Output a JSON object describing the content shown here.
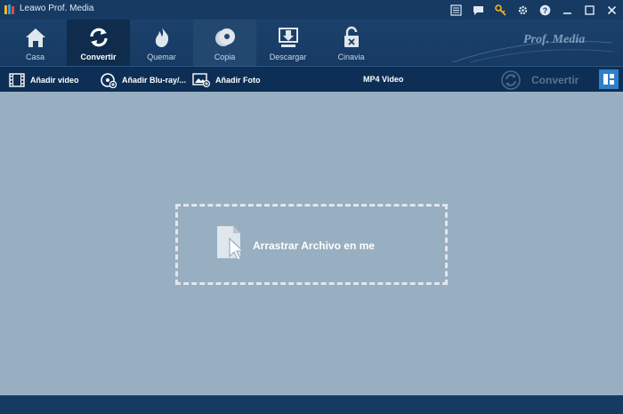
{
  "window": {
    "title": "Leawo Prof. Media"
  },
  "title_icons": [
    {
      "name": "register-icon"
    },
    {
      "name": "feedback-icon"
    },
    {
      "name": "key-icon"
    },
    {
      "name": "gear-icon"
    },
    {
      "name": "help-icon"
    },
    {
      "name": "minimize-icon"
    },
    {
      "name": "maximize-icon"
    },
    {
      "name": "close-icon"
    }
  ],
  "modules": [
    {
      "label": "Casa",
      "icon": "home-icon",
      "state": "normal"
    },
    {
      "label": "Convertir",
      "icon": "convert-icon",
      "state": "active"
    },
    {
      "label": "Quemar",
      "icon": "burn-icon",
      "state": "normal"
    },
    {
      "label": "Copia",
      "icon": "copy-disc-icon",
      "state": "highlight"
    },
    {
      "label": "Descargar",
      "icon": "download-icon",
      "state": "normal"
    },
    {
      "label": "Cinavia",
      "icon": "unlock-icon",
      "state": "normal"
    }
  ],
  "brand_text": "Prof. Media",
  "toolbar": {
    "add_video": "Añadir video",
    "add_bluray": "Añadir Blu-ray/...",
    "add_photo": "Añadir Foto",
    "format": "MP4 Video",
    "convert": "Convertir"
  },
  "dropzone": {
    "text": "Arrastrar Archivo en me"
  },
  "colors": {
    "titlebar": "#173a63",
    "toolbar": "#0d2f55",
    "workspace": "#98afc2",
    "accent": "#2f7fc9"
  }
}
